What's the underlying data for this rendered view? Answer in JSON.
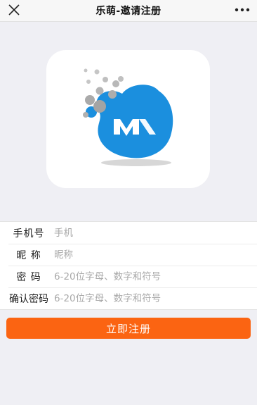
{
  "header": {
    "title": "乐萌-邀请注册",
    "close_icon": "close-icon",
    "more_icon": "more-dots-icon"
  },
  "logo": {
    "lettering": "M",
    "colors": {
      "blob": "#1b8fde",
      "dots": "#b8b8b8"
    }
  },
  "form": {
    "phone": {
      "label": "手机号",
      "placeholder": "手机"
    },
    "nickname": {
      "label": "昵 称",
      "placeholder": "昵称"
    },
    "password": {
      "label": "密 码",
      "placeholder": "6-20位字母、数字和符号"
    },
    "confirm": {
      "label": "确认密码",
      "placeholder": "6-20位字母、数字和符号"
    }
  },
  "submit_label": "立即注册",
  "colors": {
    "accent": "#fb6412",
    "background": "#efeff4"
  }
}
